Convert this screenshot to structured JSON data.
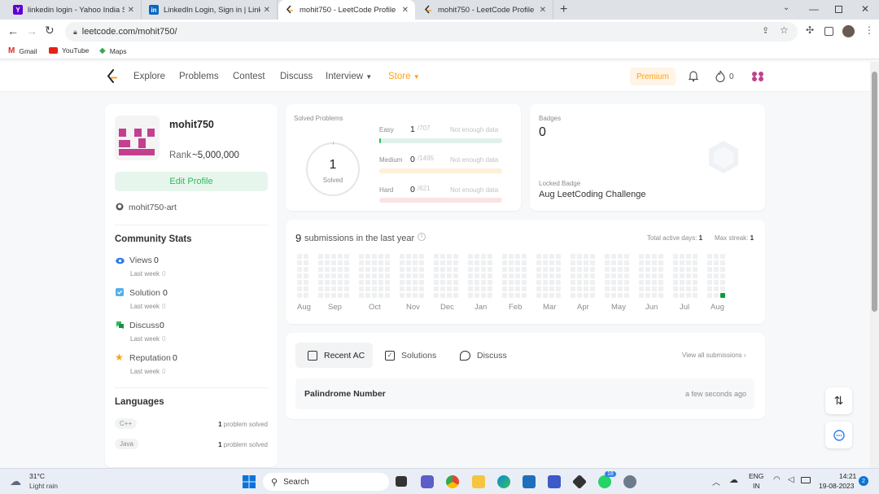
{
  "browser": {
    "tabs": [
      {
        "title": "linkedin login - Yahoo India Sear",
        "icon": "yahoo-icon"
      },
      {
        "title": "LinkedIn Login, Sign in | LinkedIn",
        "icon": "linkedin-icon"
      },
      {
        "title": "mohit750 - LeetCode Profile",
        "icon": "leetcode-icon",
        "active": true
      },
      {
        "title": "mohit750 - LeetCode Profile",
        "icon": "leetcode-icon"
      }
    ],
    "new_tab": "+",
    "url": "leetcode.com/mohit750/",
    "bookmarks": [
      "Gmail",
      "YouTube",
      "Maps"
    ]
  },
  "nav": {
    "items": [
      "Explore",
      "Problems",
      "Contest",
      "Discuss",
      "Interview",
      "Store"
    ],
    "premium": "Premium",
    "streak": "0"
  },
  "profile": {
    "username": "mohit750",
    "rank_label": "Rank",
    "rank": "~5,000,000",
    "edit": "Edit Profile",
    "github": "mohit750-art",
    "community_title": "Community Stats",
    "stats": [
      {
        "label": "Views",
        "value": "0",
        "sub": "Last week",
        "subval": "0"
      },
      {
        "label": "Solution",
        "value": "0",
        "sub": "Last week",
        "subval": "0"
      },
      {
        "label": "Discuss",
        "value": "0",
        "sub": "Last week",
        "subval": "0"
      },
      {
        "label": "Reputation",
        "value": "0",
        "sub": "Last week",
        "subval": "0"
      }
    ],
    "languages_title": "Languages",
    "languages": [
      {
        "name": "C++",
        "count": "1",
        "suffix": "problem solved"
      },
      {
        "name": "Java",
        "count": "1",
        "suffix": "problem solved"
      }
    ]
  },
  "solved": {
    "title": "Solved Problems",
    "count": "1",
    "label": "Solved",
    "rows": [
      {
        "name": "Easy",
        "value": "1",
        "total": "/707",
        "note": "Not enough data",
        "track": "#dff1ea",
        "fill": "#2cbb5d",
        "fraction": 0.0014
      },
      {
        "name": "Medium",
        "value": "0",
        "total": "/1495",
        "note": "Not enough data",
        "track": "#fdf1d6",
        "fill": "#ffc01e",
        "fraction": 0
      },
      {
        "name": "Hard",
        "value": "0",
        "total": "/621",
        "note": "Not enough data",
        "track": "#fce3e3",
        "fill": "#ef4743",
        "fraction": 0
      }
    ]
  },
  "badges": {
    "title": "Badges",
    "count": "0",
    "locked_label": "Locked Badge",
    "locked_name": "Aug LeetCoding Challenge"
  },
  "submissions": {
    "count": "9",
    "text": "submissions in the last year",
    "active_label": "Total active days:",
    "active": "1",
    "streak_label": "Max streak:",
    "streak": "1",
    "months": [
      "Aug",
      "Sep",
      "Oct",
      "Nov",
      "Dec",
      "Jan",
      "Feb",
      "Mar",
      "Apr",
      "May",
      "Jun",
      "Jul",
      "Aug"
    ]
  },
  "recent": {
    "tabs": [
      "Recent AC",
      "Solutions",
      "Discuss"
    ],
    "view_all": "View all submissions",
    "items": [
      {
        "title": "Palindrome Number",
        "time": "a few seconds ago"
      }
    ]
  },
  "taskbar": {
    "temp": "31°C",
    "weather": "Light rain",
    "search": "Search",
    "lang1": "ENG",
    "lang2": "IN",
    "time": "14:21",
    "date": "19-08-2023",
    "notif": "2",
    "whatsapp_badge": "18"
  },
  "colors": {
    "brand": "#ffa116",
    "easy": "#2cbb5d",
    "medium": "#ffc01e",
    "hard": "#ef4743",
    "heat_active": "#109a3c",
    "heat_empty": "#eef0f2"
  }
}
